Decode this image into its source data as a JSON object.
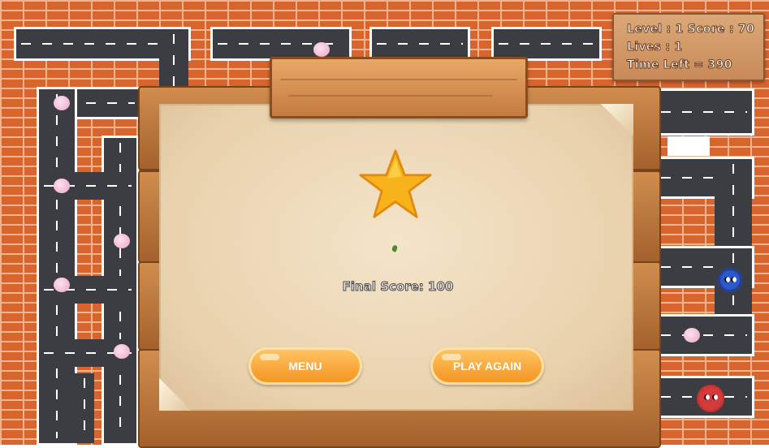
{
  "hud": {
    "level_score": "Level : 1  Score : 70",
    "lives": "Lives : 1",
    "time_left": "Time Left = 390"
  },
  "dialog": {
    "final_score": "Final Score: 100",
    "menu_button": "MENU",
    "play_again_button": "PLAY AGAIN"
  },
  "colors": {
    "brick": "#d8652e",
    "mortar": "#f0b48e",
    "road": "#3b3d42",
    "button_orange": "#f8a63a",
    "star_gold": "#f7b21c"
  },
  "icons": {
    "star": "star-icon",
    "blue_virus": "blue-virus-enemy",
    "red_virus": "red-virus-enemy",
    "pellet": "candy-pellet"
  }
}
